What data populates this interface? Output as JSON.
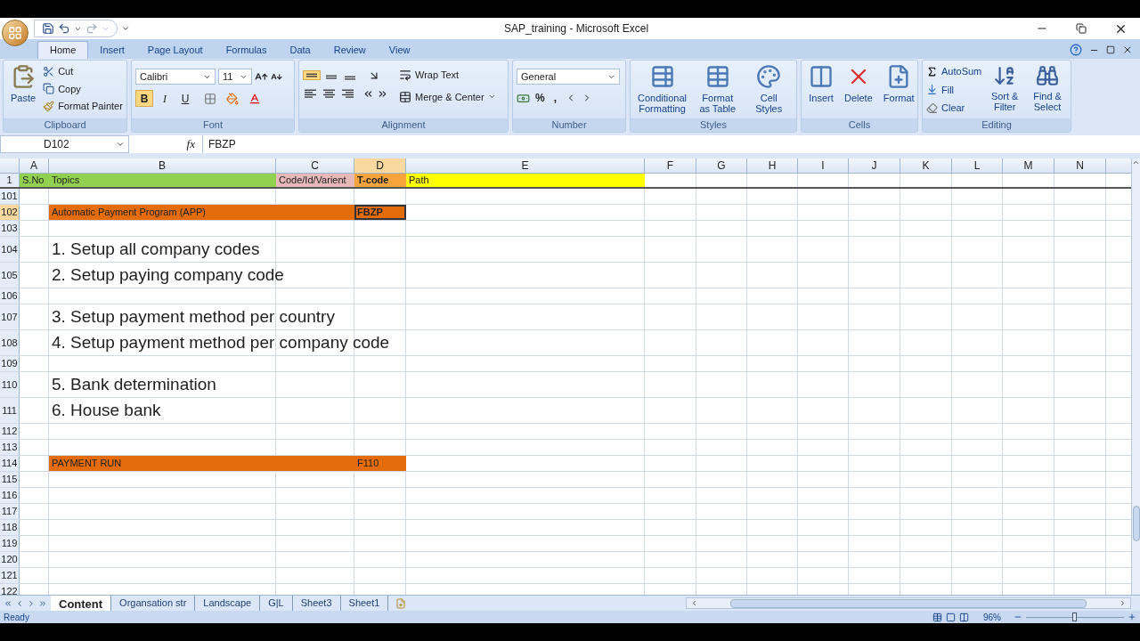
{
  "window": {
    "title": "SAP_training - Microsoft Excel"
  },
  "ribbon": {
    "tabs": [
      {
        "label": "Home",
        "selected": true
      },
      {
        "label": "Insert",
        "selected": false
      },
      {
        "label": "Page Layout",
        "selected": false
      },
      {
        "label": "Formulas",
        "selected": false
      },
      {
        "label": "Data",
        "selected": false
      },
      {
        "label": "Review",
        "selected": false
      },
      {
        "label": "View",
        "selected": false
      }
    ],
    "clipboard": {
      "label": "Clipboard",
      "paste": "Paste",
      "cut": "Cut",
      "copy": "Copy",
      "format_painter": "Format Painter"
    },
    "font": {
      "label": "Font",
      "name": "Calibri",
      "size": "11",
      "bold": {
        "text": "B",
        "on": true
      },
      "italic": {
        "text": "I",
        "on": false
      },
      "underline": {
        "text": "U",
        "on": false
      }
    },
    "alignment": {
      "label": "Alignment",
      "top_align_on": true,
      "wrap_text": "Wrap Text",
      "merge_center": "Merge & Center"
    },
    "number": {
      "label": "Number",
      "format": "General",
      "percent": "%",
      "comma": ","
    },
    "styles": {
      "label": "Styles",
      "buttons": [
        "Conditional Formatting",
        "Format as Table",
        "Cell Styles"
      ]
    },
    "cells": {
      "label": "Cells",
      "buttons": [
        "Insert",
        "Delete",
        "Format"
      ]
    },
    "editing": {
      "label": "Editing",
      "autosum": "AutoSum",
      "fill": "Fill",
      "clear": "Clear",
      "buttons": [
        "Sort & Filter",
        "Find & Select"
      ]
    }
  },
  "formula_bar": {
    "name_box": "D102",
    "fx": "fx",
    "value": "FBZP"
  },
  "columns": [
    {
      "label": "A",
      "selected": false
    },
    {
      "label": "B",
      "selected": false
    },
    {
      "label": "C",
      "selected": false
    },
    {
      "label": "D",
      "selected": true
    },
    {
      "label": "E",
      "selected": false
    },
    {
      "label": "F",
      "selected": false
    },
    {
      "label": "G",
      "selected": false
    },
    {
      "label": "H",
      "selected": false
    },
    {
      "label": "I",
      "selected": false
    },
    {
      "label": "J",
      "selected": false
    },
    {
      "label": "K",
      "selected": false
    },
    {
      "label": "L",
      "selected": false
    },
    {
      "label": "M",
      "selected": false
    },
    {
      "label": "N",
      "selected": false
    }
  ],
  "rows": [
    {
      "number": "1",
      "kind": "header",
      "selected": false,
      "cells": {
        "A": {
          "text": "S.No",
          "color": "#92d050",
          "bold": false,
          "selected": false
        },
        "B": {
          "text": "Topics",
          "color": "#92d050",
          "bold": false,
          "selected": false
        },
        "C": {
          "text": "Code/Id/Varient",
          "color": "#e6b8b7",
          "bold": false,
          "selected": false
        },
        "D": {
          "text": "T-code",
          "color": "#f7a43c",
          "bold": true,
          "selected": false
        },
        "E": {
          "text": "Path",
          "color": "#ffff00",
          "bold": false,
          "selected": false
        }
      }
    },
    {
      "number": "101",
      "kind": "normal",
      "selected": false
    },
    {
      "number": "102",
      "kind": "normal",
      "selected": true,
      "cells": {
        "B": {
          "text": "Automatic Payment Program (APP)",
          "color": "#e46c0a",
          "bold": false,
          "selected": false
        },
        "C": {
          "color": "#e46c0a",
          "selected": false
        },
        "D": {
          "text": "FBZP",
          "color": "#e46c0a",
          "bold": true,
          "selected": true
        }
      }
    },
    {
      "number": "103",
      "kind": "normal",
      "selected": false
    },
    {
      "number": "104",
      "kind": "large",
      "selected": false,
      "cells": {
        "B": {
          "text": "1. Setup all company codes",
          "bold": false,
          "selected": false
        }
      }
    },
    {
      "number": "105",
      "kind": "large",
      "selected": false,
      "cells": {
        "B": {
          "text": "2. Setup paying company code",
          "bold": false,
          "selected": false
        }
      }
    },
    {
      "number": "106",
      "kind": "normal",
      "selected": false
    },
    {
      "number": "107",
      "kind": "large",
      "selected": false,
      "cells": {
        "B": {
          "text": "3. Setup payment method per country",
          "bold": false,
          "selected": false
        }
      }
    },
    {
      "number": "108",
      "kind": "large",
      "selected": false,
      "cells": {
        "B": {
          "text": "4. Setup payment method per company code",
          "bold": false,
          "selected": false
        }
      }
    },
    {
      "number": "109",
      "kind": "normal",
      "selected": false
    },
    {
      "number": "110",
      "kind": "large",
      "selected": false,
      "cells": {
        "B": {
          "text": "5. Bank determination",
          "bold": false,
          "selected": false
        }
      }
    },
    {
      "number": "111",
      "kind": "large",
      "selected": false,
      "cells": {
        "B": {
          "text": "6. House bank",
          "bold": false,
          "selected": false
        }
      }
    },
    {
      "number": "112",
      "kind": "normal",
      "selected": false
    },
    {
      "number": "113",
      "kind": "normal",
      "selected": false
    },
    {
      "number": "114",
      "kind": "normal",
      "selected": false,
      "cells": {
        "B": {
          "text": "PAYMENT RUN",
          "color": "#e46c0a",
          "bold": false,
          "selected": false
        },
        "C": {
          "color": "#e46c0a",
          "selected": false
        },
        "D": {
          "text": "F110",
          "color": "#e46c0a",
          "bold": false,
          "selected": false
        }
      }
    },
    {
      "number": "115",
      "kind": "normal",
      "selected": false
    },
    {
      "number": "116",
      "kind": "normal",
      "selected": false
    },
    {
      "number": "117",
      "kind": "normal",
      "selected": false
    },
    {
      "number": "118",
      "kind": "normal",
      "selected": false
    },
    {
      "number": "119",
      "kind": "normal",
      "selected": false
    },
    {
      "number": "120",
      "kind": "normal",
      "selected": false
    },
    {
      "number": "121",
      "kind": "normal",
      "selected": false
    },
    {
      "number": "122",
      "kind": "normal",
      "selected": false
    }
  ],
  "sheet_tabs": [
    {
      "label": "Content",
      "selected": true
    },
    {
      "label": "Organsation str",
      "selected": false
    },
    {
      "label": "Landscape",
      "selected": false
    },
    {
      "label": "G|L",
      "selected": false
    },
    {
      "label": "Sheet3",
      "selected": false
    },
    {
      "label": "Sheet1",
      "selected": false
    }
  ],
  "status_bar": {
    "status": "Ready",
    "zoom": "96%",
    "zoom_slider": {
      "level": 0.5
    }
  }
}
